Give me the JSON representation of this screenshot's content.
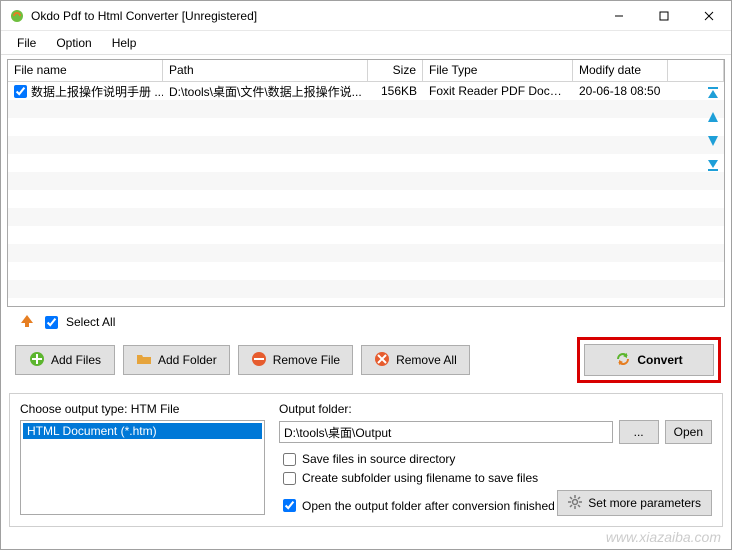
{
  "window": {
    "title": "Okdo Pdf to Html Converter [Unregistered]"
  },
  "menu": {
    "file": "File",
    "option": "Option",
    "help": "Help"
  },
  "columns": {
    "fname": "File name",
    "fpath": "Path",
    "fsize": "Size",
    "ftype": "File Type",
    "fdate": "Modify date"
  },
  "files": [
    {
      "checked": true,
      "name": "数据上报操作说明手册 ...",
      "path": "D:\\tools\\桌面\\文件\\数据上报操作说...",
      "size": "156KB",
      "type": "Foxit Reader PDF Docum...",
      "date": "20-06-18 08:50"
    }
  ],
  "selectall": {
    "label": "Select All",
    "checked": true
  },
  "buttons": {
    "addfiles": "Add Files",
    "addfolder": "Add Folder",
    "removefile": "Remove File",
    "removeall": "Remove All",
    "convert": "Convert"
  },
  "output": {
    "choose_label": "Choose output type:",
    "choose_value": "HTM File",
    "option_html": "HTML Document (*.htm)",
    "folder_label": "Output folder:",
    "folder_value": "D:\\tools\\桌面\\Output",
    "browse": "...",
    "open": "Open",
    "save_source": {
      "label": "Save files in source directory",
      "checked": false
    },
    "create_sub": {
      "label": "Create subfolder using filename to save files",
      "checked": false
    },
    "open_after": {
      "label": "Open the output folder after conversion finished",
      "checked": true
    },
    "more": "Set more parameters"
  },
  "watermark": "www.xiazaiba.com"
}
